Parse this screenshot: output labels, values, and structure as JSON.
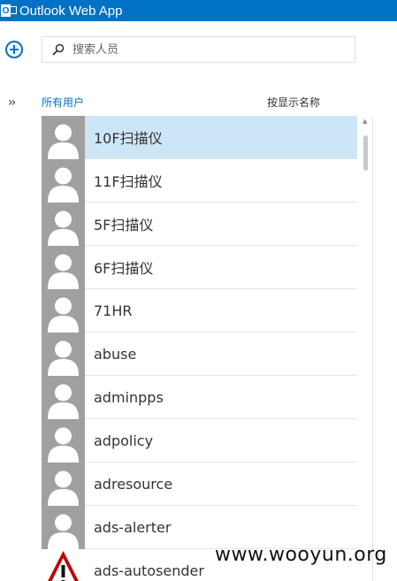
{
  "app": {
    "title": "Outlook Web App",
    "logo_letter": "O"
  },
  "search": {
    "placeholder": "搜索人员"
  },
  "filter": {
    "label": "所有用户"
  },
  "sort": {
    "label": "按显示名称"
  },
  "contacts": [
    {
      "name": "10F扫描仪",
      "selected": true,
      "avatar": "person"
    },
    {
      "name": "11F扫描仪",
      "selected": false,
      "avatar": "person"
    },
    {
      "name": "5F扫描仪",
      "selected": false,
      "avatar": "person"
    },
    {
      "name": "6F扫描仪",
      "selected": false,
      "avatar": "person"
    },
    {
      "name": "71HR",
      "selected": false,
      "avatar": "person"
    },
    {
      "name": "abuse",
      "selected": false,
      "avatar": "person"
    },
    {
      "name": "adminpps",
      "selected": false,
      "avatar": "person"
    },
    {
      "name": "adpolicy",
      "selected": false,
      "avatar": "person"
    },
    {
      "name": "adresource",
      "selected": false,
      "avatar": "person"
    },
    {
      "name": "ads-alerter",
      "selected": false,
      "avatar": "person"
    },
    {
      "name": "ads-autosender",
      "selected": false,
      "avatar": "warning"
    }
  ],
  "watermark": "www.wooyun.org",
  "colors": {
    "brand": "#0072c6",
    "selected_row": "#cde6f7",
    "avatar_bg": "#a0a0a0"
  }
}
